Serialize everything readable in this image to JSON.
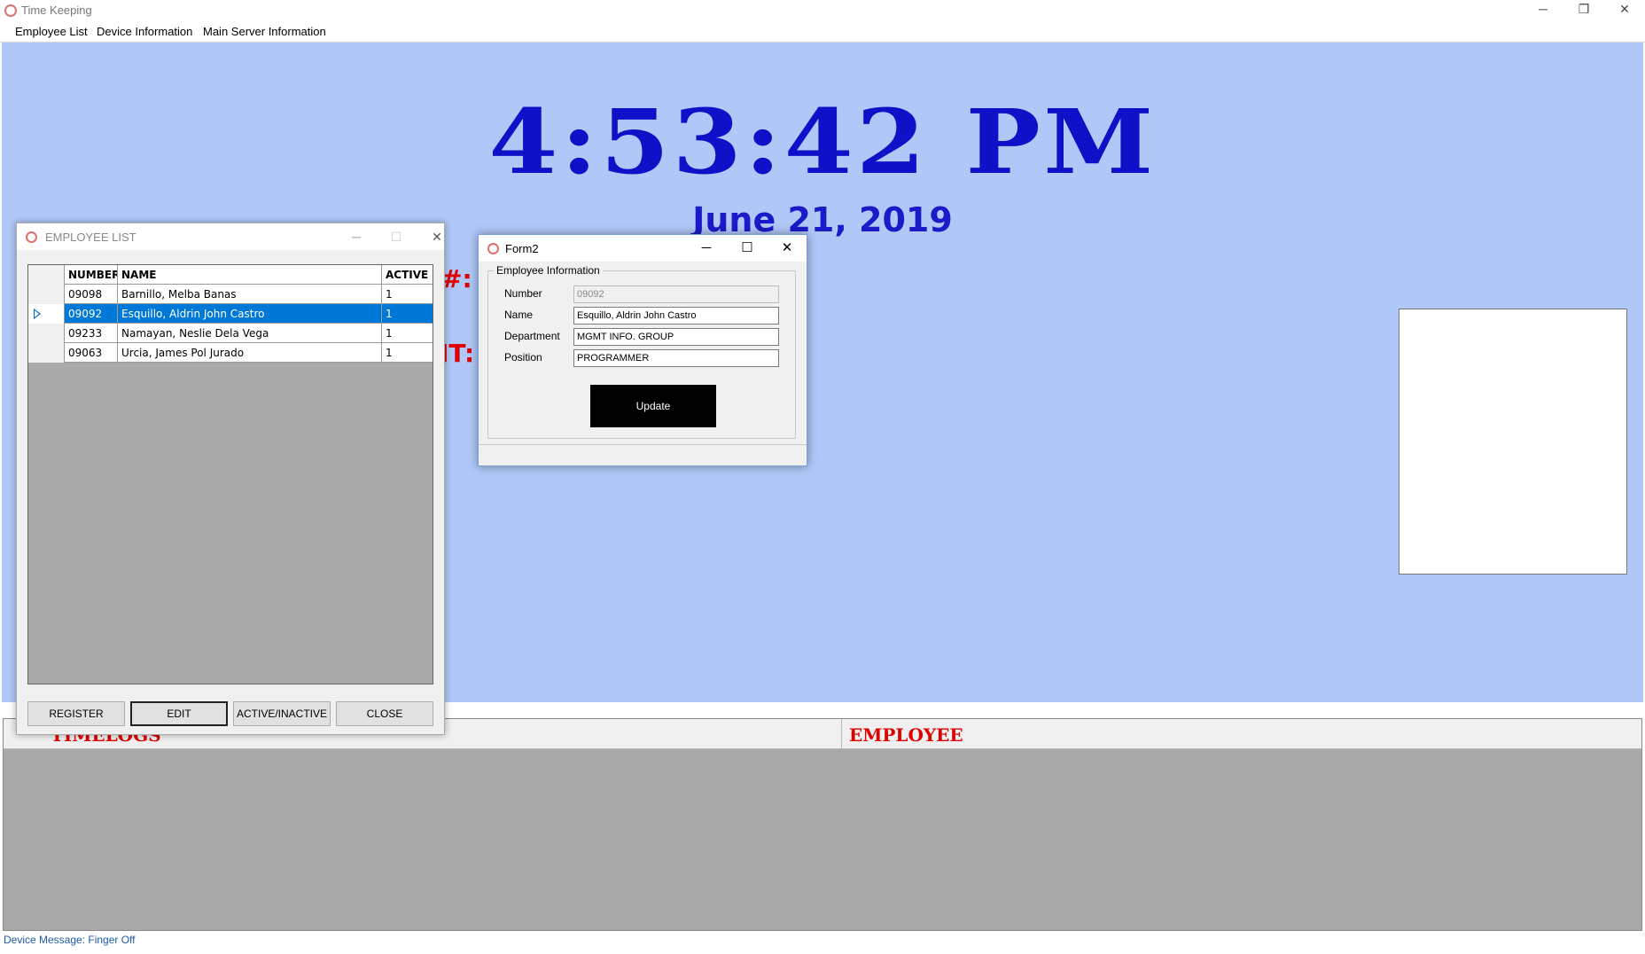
{
  "window": {
    "title": "Time Keeping",
    "minimize": "─",
    "restore": "❐",
    "close": "✕"
  },
  "menu": {
    "items": [
      "Employee List",
      "Device Information",
      "Main Server Information"
    ]
  },
  "clock": {
    "time": "4:53:42 PM",
    "date": "June 21, 2019"
  },
  "hidden_labels": {
    "number_suffix": "#:",
    "count_suffix": "IT:"
  },
  "bottom": {
    "timelogs": "TIMELOGS",
    "employee": "EMPLOYEE"
  },
  "status": {
    "message": "Device Message: Finger Off"
  },
  "employee_list": {
    "title": "EMPLOYEE LIST",
    "columns": [
      "NUMBER",
      "NAME",
      "ACTIVE"
    ],
    "rows": [
      {
        "number": "09098",
        "name": "Barnillo, Melba Banas",
        "active": "1",
        "selected": false
      },
      {
        "number": "09092",
        "name": "Esquillo, Aldrin John Castro",
        "active": "1",
        "selected": true
      },
      {
        "number": "09233",
        "name": "Namayan, Neslie Dela Vega",
        "active": "1",
        "selected": false
      },
      {
        "number": "09063",
        "name": "Urcia, James Pol Jurado",
        "active": "1",
        "selected": false
      }
    ],
    "buttons": [
      "REGISTER",
      "EDIT",
      "ACTIVE/INACTIVE",
      "CLOSE"
    ]
  },
  "form2": {
    "title": "Form2",
    "group_title": "Employee Information",
    "fields": [
      {
        "label": "Number",
        "value": "09092",
        "disabled": true
      },
      {
        "label": "Name",
        "value": "Esquillo, Aldrin John Castro",
        "disabled": false
      },
      {
        "label": "Department",
        "value": "MGMT INFO. GROUP",
        "disabled": false
      },
      {
        "label": "Position",
        "value": "PROGRAMMER",
        "disabled": false
      }
    ],
    "update_label": "Update"
  },
  "colors": {
    "background": "#b0c8f8",
    "clock": "#1010c8",
    "accent_red": "#e00000",
    "selection": "#0078d7"
  }
}
